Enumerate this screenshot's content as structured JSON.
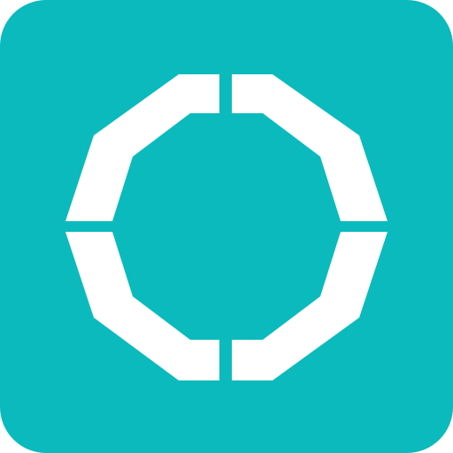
{
  "icon": {
    "name": "decagon-ring-icon",
    "background_color": "#0BBABC",
    "glyph_color": "#FFFFFF"
  }
}
